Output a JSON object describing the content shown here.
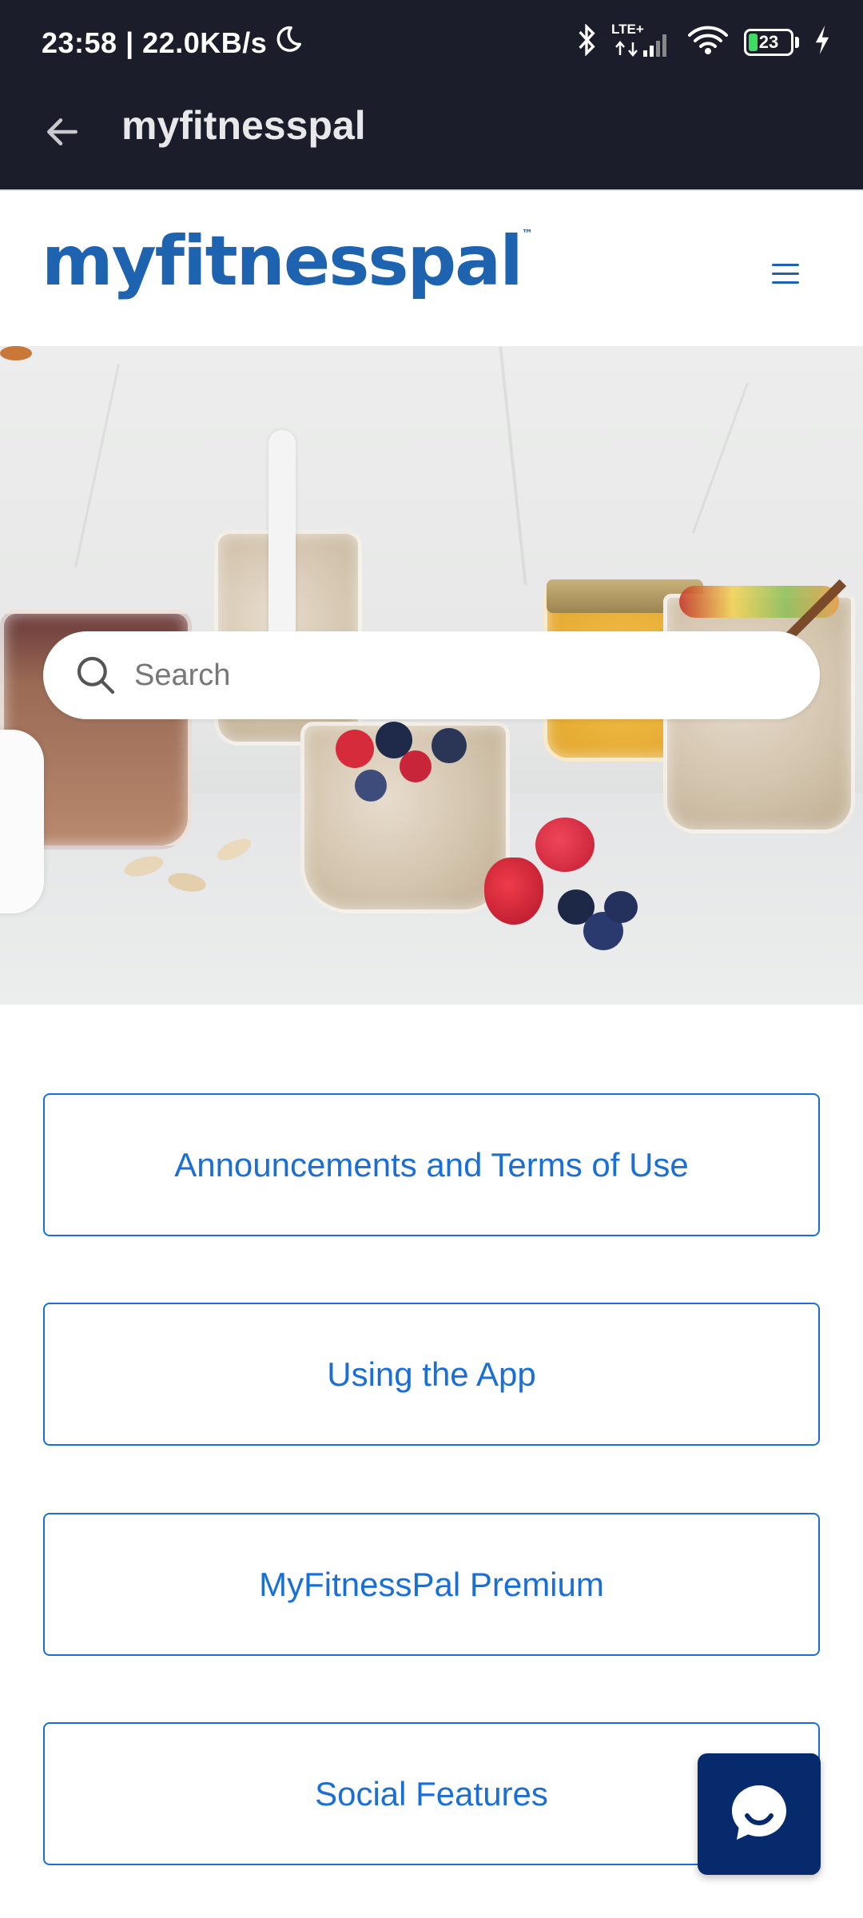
{
  "status_bar": {
    "time_speed": "23:58 | 22.0KB/s",
    "network": "LTE+",
    "battery_level": "23"
  },
  "app_bar": {
    "title": "myfitnesspal"
  },
  "site": {
    "logo_text": "myfitnesspal",
    "logo_tm": "™"
  },
  "search": {
    "placeholder": "Search"
  },
  "categories": [
    {
      "label": "Announcements and Terms of Use"
    },
    {
      "label": "Using the App"
    },
    {
      "label": "MyFitnessPal Premium"
    },
    {
      "label": "Social Features"
    }
  ],
  "colors": {
    "topbar": "#1b1e2a",
    "brand_blue": "#1e63b0",
    "link_blue": "#1a6fd6",
    "fab": "#062a6b"
  },
  "icons": [
    "moon-icon",
    "bluetooth-icon",
    "signal-icon",
    "wifi-icon",
    "battery-icon",
    "charging-icon",
    "back-arrow-icon",
    "hamburger-menu-icon",
    "search-icon",
    "chat-icon"
  ]
}
